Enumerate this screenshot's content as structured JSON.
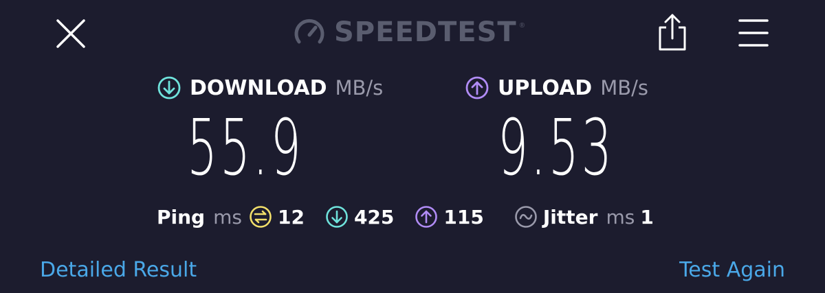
{
  "header": {
    "brand": "SPEEDTEST",
    "brand_mark": "®",
    "icons": {
      "close": "close-icon",
      "logo": "speedometer-icon",
      "share": "share-icon",
      "menu": "menu-icon"
    }
  },
  "download": {
    "label": "DOWNLOAD",
    "unit": "MB/s",
    "value": "55.9",
    "icon": "download-arrow-icon",
    "icon_color": "#6fe3dc"
  },
  "upload": {
    "label": "UPLOAD",
    "unit": "MB/s",
    "value": "9.53",
    "icon": "upload-arrow-icon",
    "icon_color": "#b18cf6"
  },
  "stats": {
    "ping_label": "Ping",
    "ping_unit": "ms",
    "ping_idle": "12",
    "ping_idle_color": "#f2df6a",
    "ping_download": "425",
    "ping_upload": "115",
    "jitter_label": "Jitter",
    "jitter_unit": "ms",
    "jitter_value": "1",
    "jitter_color": "#9a9aab"
  },
  "footer": {
    "detailed_result": "Detailed Result",
    "test_again": "Test Again"
  }
}
